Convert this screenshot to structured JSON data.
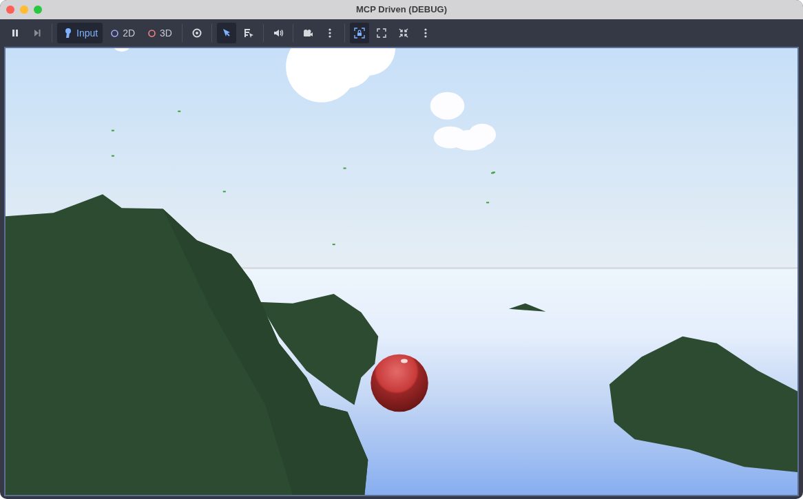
{
  "window": {
    "title": "MCP Driven (DEBUG)"
  },
  "toolbar": [
    {
      "kind": "pause",
      "selected": false
    },
    {
      "kind": "step",
      "selected": false
    },
    {
      "kind": "divider"
    },
    {
      "kind": "input",
      "label": "Input",
      "selected": true
    },
    {
      "kind": "plane",
      "label": "2D",
      "selected": false
    },
    {
      "kind": "space",
      "label": "3D",
      "selected": false
    },
    {
      "kind": "divider"
    },
    {
      "kind": "eye",
      "selected": false
    },
    {
      "kind": "divider"
    },
    {
      "kind": "pointer",
      "selected": true
    },
    {
      "kind": "list-pointer",
      "selected": false
    },
    {
      "kind": "divider"
    },
    {
      "kind": "speaker",
      "selected": false
    },
    {
      "kind": "divider"
    },
    {
      "kind": "camera",
      "selected": false
    },
    {
      "kind": "more",
      "selected": false
    },
    {
      "kind": "divider"
    },
    {
      "kind": "lock",
      "selected": true
    },
    {
      "kind": "expand",
      "selected": false
    },
    {
      "kind": "shrink",
      "selected": false
    },
    {
      "kind": "more",
      "selected": false
    }
  ]
}
